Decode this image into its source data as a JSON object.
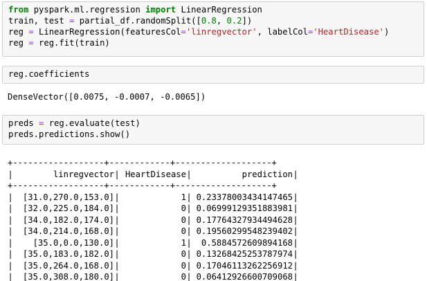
{
  "cells": [
    {
      "lines": [
        {
          "parts": [
            [
              "kw",
              "from"
            ],
            [
              "txt",
              " pyspark.ml.regression "
            ],
            [
              "kw",
              "import"
            ],
            [
              "txt",
              " LinearRegression"
            ]
          ]
        },
        {
          "parts": [
            [
              "txt",
              "train, test "
            ],
            [
              "op",
              "="
            ],
            [
              "txt",
              " partial_df.randomSplit(["
            ],
            [
              "num",
              "0.8"
            ],
            [
              "txt",
              ", "
            ],
            [
              "num",
              "0.2"
            ],
            [
              "txt",
              "])"
            ]
          ]
        },
        {
          "parts": [
            [
              "txt",
              "reg "
            ],
            [
              "op",
              "="
            ],
            [
              "txt",
              " LinearRegression(featuresCol"
            ],
            [
              "op",
              "="
            ],
            [
              "str",
              "'linregvector'"
            ],
            [
              "txt",
              ", labelCol"
            ],
            [
              "op",
              "="
            ],
            [
              "str",
              "'HeartDisease'"
            ],
            [
              "txt",
              ")"
            ]
          ]
        },
        {
          "parts": [
            [
              "txt",
              "reg "
            ],
            [
              "op",
              "="
            ],
            [
              "txt",
              " reg.fit(train)"
            ]
          ]
        }
      ]
    },
    {
      "lines": [
        {
          "parts": [
            [
              "txt",
              "reg.coefficients"
            ]
          ]
        }
      ]
    },
    {
      "lines": [
        {
          "parts": [
            [
              "txt",
              "preds "
            ],
            [
              "op",
              "="
            ],
            [
              "txt",
              " reg.evaluate(test)"
            ]
          ]
        },
        {
          "parts": [
            [
              "txt",
              "preds.predictions.show()"
            ]
          ]
        }
      ]
    }
  ],
  "coefficients_output": "DenseVector([0.0075, -0.0007, -0.0065])",
  "table": {
    "separator": "+------------------+------------+-------------------+",
    "headers": [
      "linregvector",
      "HeartDisease",
      "prediction"
    ],
    "rows": [
      [
        "[31.0,270.0,153.0]",
        "1",
        "0.23378003434147465"
      ],
      [
        "[32.0,225.0,184.0]",
        "0",
        "0.06999129351883981"
      ],
      [
        "[34.0,182.0,174.0]",
        "0",
        "0.17764327934494628"
      ],
      [
        "[34.0,214.0,168.0]",
        "0",
        "0.19560299548239402"
      ],
      [
        "[35.0,0.0,130.0]",
        "1",
        "0.5884572609894168"
      ],
      [
        "[35.0,183.0,182.0]",
        "0",
        "0.13268425253787974"
      ],
      [
        "[35.0,264.0,168.0]",
        "0",
        "0.17046113262256912"
      ],
      [
        "[35.0,308.0,180.0]",
        "0",
        "0.06412926600709068"
      ]
    ]
  }
}
